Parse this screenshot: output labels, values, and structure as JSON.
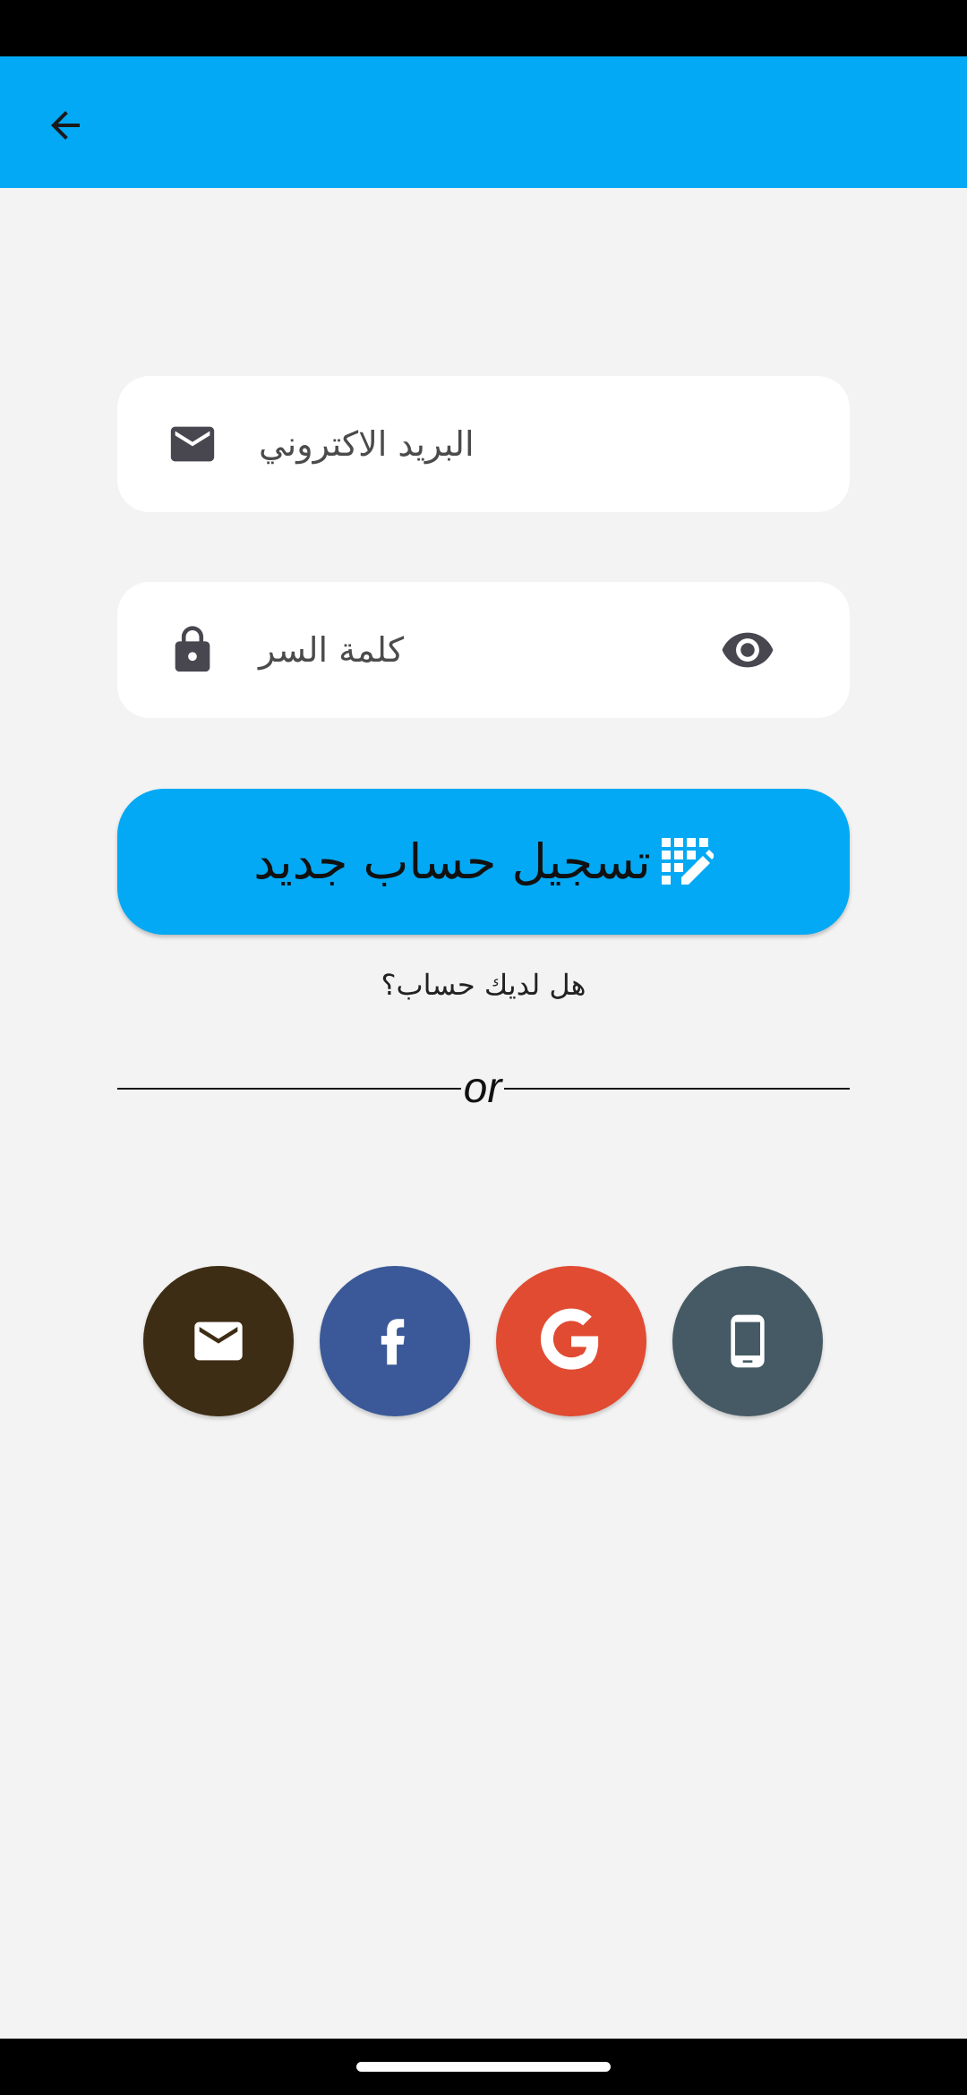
{
  "app_bar": {
    "back_icon": "arrow-back-icon",
    "color": "#03a9f4"
  },
  "form": {
    "email": {
      "placeholder": "البريد الاكتروني",
      "icon": "envelope-icon"
    },
    "password": {
      "placeholder": "كلمة السر",
      "icon": "lock-icon",
      "toggle_icon": "eye-icon"
    },
    "register_button": {
      "label": "تسجيل حساب جديد",
      "icon": "registration-icon",
      "color": "#03a9f4"
    },
    "have_account_label": "هل لديك حساب؟"
  },
  "divider": {
    "label": "or"
  },
  "social": [
    {
      "name": "email",
      "icon": "envelope-icon",
      "color": "#3e2d15"
    },
    {
      "name": "facebook",
      "icon": "facebook-icon",
      "color": "#3b5998"
    },
    {
      "name": "google",
      "icon": "google-icon",
      "color": "#e04b32"
    },
    {
      "name": "phone",
      "icon": "phone-icon",
      "color": "#455a64"
    }
  ]
}
